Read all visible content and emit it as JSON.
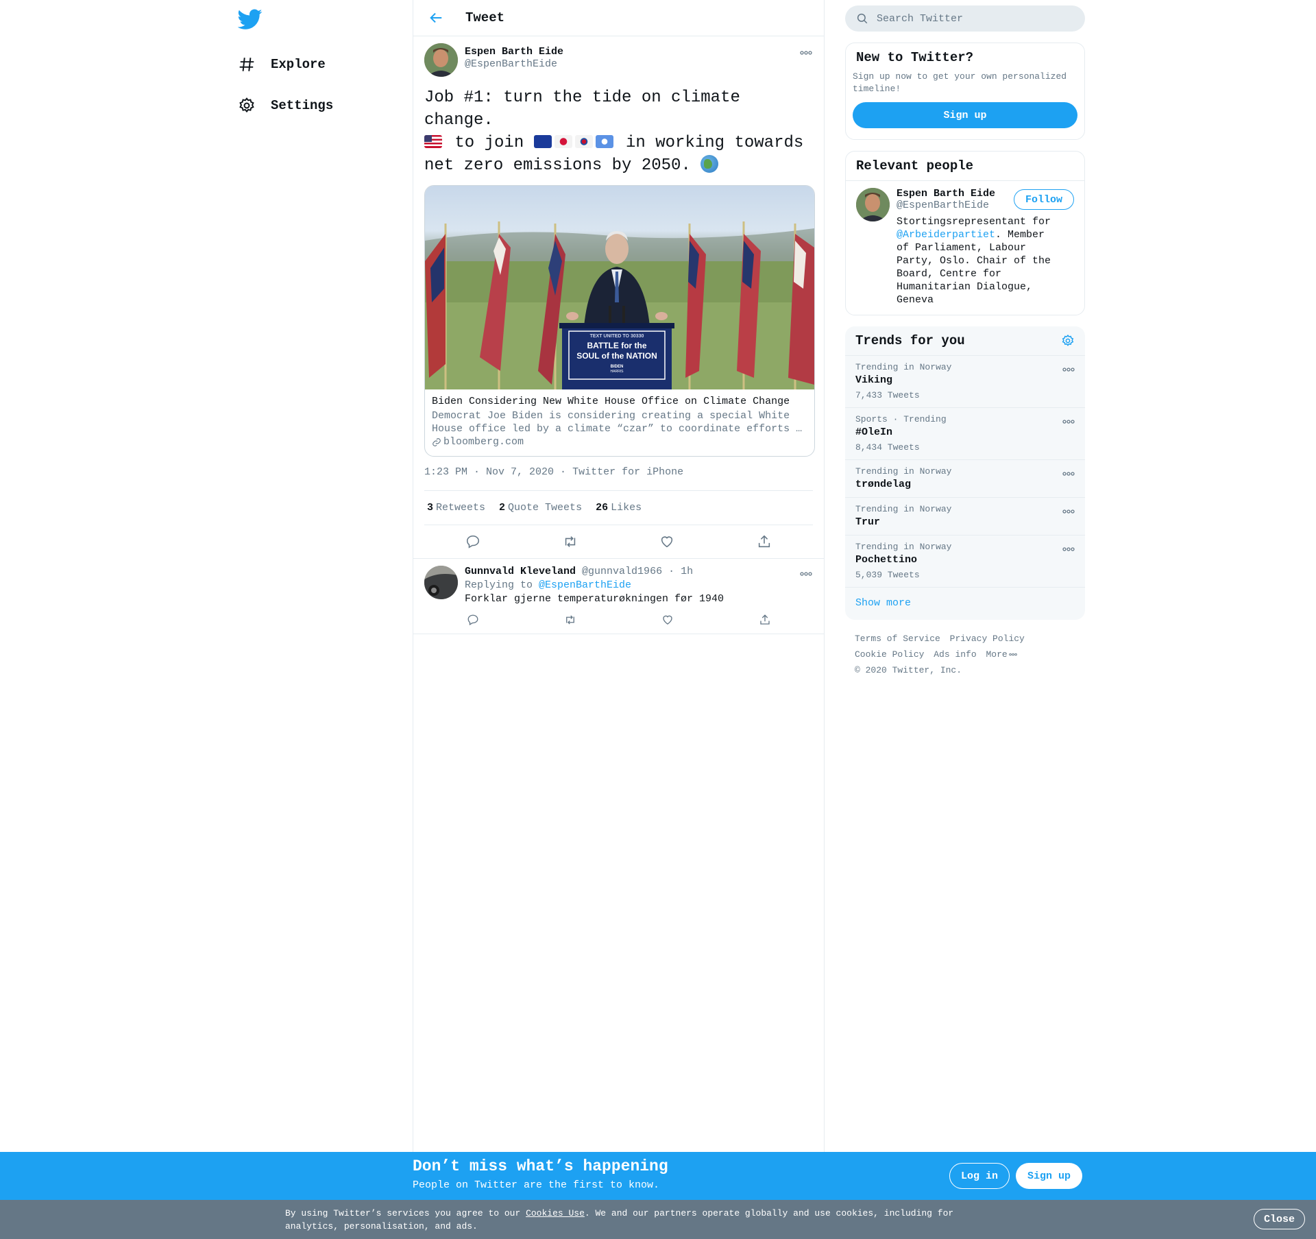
{
  "nav": {
    "items": [
      {
        "label": "Explore",
        "icon": "hashtag-icon"
      },
      {
        "label": "Settings",
        "icon": "gear-icon"
      }
    ]
  },
  "header": {
    "title": "Tweet"
  },
  "tweet": {
    "author_name": "Espen Barth Eide",
    "author_handle": "@EspenBarthEide",
    "text_line1": "Job #1: turn the tide on climate change.",
    "text_to_join": " to join ",
    "text_working": " in working towards",
    "text_line3": "net zero emissions by 2050. ",
    "flags": [
      "flag-us",
      "flag-eu",
      "flag-jp",
      "flag-kr",
      "flag-un"
    ],
    "card": {
      "title": "Biden Considering New White House Office on Climate Change",
      "description": "Democrat Joe Biden is considering creating a special White House office led by a climate “czar” to coordinate efforts …",
      "domain": "bloomberg.com",
      "image": {
        "sign_small": "TEXT UNITED TO 30330",
        "sign_line1": "BATTLE for the",
        "sign_line2": "SOUL of the NATION",
        "sign_logo1": "BIDEN",
        "sign_logo2": "HARRIS"
      }
    },
    "time": "1:23 PM · Nov 7, 2020",
    "source": "Twitter for iPhone",
    "stats": [
      {
        "num": "3",
        "label": "Retweets"
      },
      {
        "num": "2",
        "label": "Quote Tweets"
      },
      {
        "num": "26",
        "label": "Likes"
      }
    ]
  },
  "reply": {
    "name": "Gunnvald Kleveland",
    "handle": "@gunnvald1966",
    "time": "1h",
    "replying_prefix": "Replying to ",
    "replying_to": "@EspenBarthEide",
    "text": "Forklar gjerne temperaturøkningen før 1940"
  },
  "search": {
    "placeholder": "Search Twitter"
  },
  "new_to_twitter": {
    "title": "New to Twitter?",
    "desc": "Sign up now to get your own personalized timeline!",
    "button": "Sign up"
  },
  "relevant": {
    "title": "Relevant people",
    "name": "Espen Barth Eide",
    "handle": "@EspenBarthEide",
    "follow": "Follow",
    "bio_prefix": "Stortingsrepresentant for ",
    "bio_link": "@Arbeiderpartiet",
    "bio_suffix": ". Member of Parliament, Labour Party, Oslo. Chair of the Board, Centre for Humanitarian Dialogue, Geneva"
  },
  "trends": {
    "title": "Trends for you",
    "items": [
      {
        "context": "Trending in Norway",
        "name": "Viking",
        "count": "7,433 Tweets"
      },
      {
        "context": "Sports · Trending",
        "name": "#OleIn",
        "count": "8,434 Tweets"
      },
      {
        "context": "Trending in Norway",
        "name": "trøndelag",
        "count": ""
      },
      {
        "context": "Trending in Norway",
        "name": "Trur",
        "count": ""
      },
      {
        "context": "Trending in Norway",
        "name": "Pochettino",
        "count": "5,039 Tweets"
      }
    ],
    "show_more": "Show more"
  },
  "footer": {
    "terms": "Terms of Service",
    "privacy": "Privacy Policy",
    "cookie": "Cookie Policy",
    "ads": "Ads info",
    "more": "More",
    "copyright": "© 2020 Twitter, Inc."
  },
  "bottom_bar": {
    "title": "Don’t miss what’s happening",
    "subtitle": "People on Twitter are the first to know.",
    "login": "Log in",
    "signup": "Sign up"
  },
  "cookie_bar": {
    "prefix": "By using Twitter’s services you agree to our ",
    "link": "Cookies Use",
    "suffix": ". We and our partners operate globally and use cookies, including for analytics, personalisation, and ads.",
    "close": "Close"
  },
  "colors": {
    "accent": "#1da1f2",
    "muted": "#657786",
    "border": "#e6ecf0"
  }
}
